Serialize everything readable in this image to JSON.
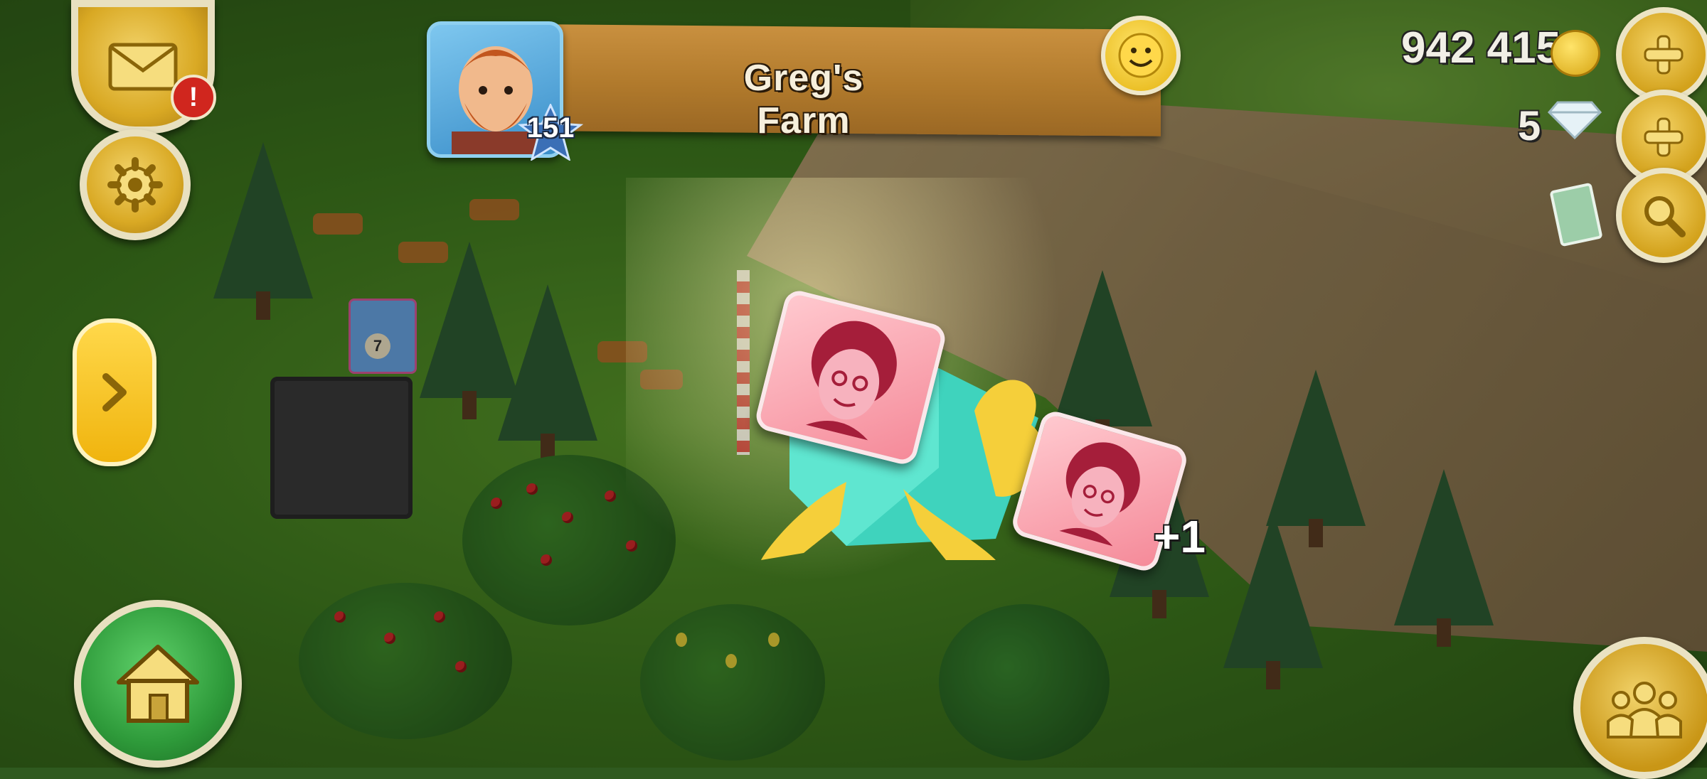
{
  "farm": {
    "name": "Greg's Farm",
    "level": "151"
  },
  "resources": {
    "coins": "942 415",
    "diamonds": "5"
  },
  "hud": {
    "alert_badge": "!",
    "icons": {
      "mail": "envelope-icon",
      "settings": "gear-icon",
      "expand": "chevron-right-icon",
      "home": "house-icon",
      "friends": "people-icon",
      "smiley": "smiley-face-icon",
      "coin": "gold-coin-icon",
      "diamond": "diamond-icon",
      "search": "magnifier-icon",
      "plus": "plus-icon"
    }
  },
  "reward": {
    "gain_text": "+1",
    "item": "portrait-card"
  },
  "scene": {
    "gift_tag_number": "7"
  },
  "colors": {
    "accent_gold": "#e4b20e",
    "banner_wood": "#b17a2c",
    "card_pink": "#f58a99",
    "gift_teal": "#4fd8c4",
    "ribbon_yellow": "#f5cf3a",
    "home_green": "#2e9a3a"
  }
}
